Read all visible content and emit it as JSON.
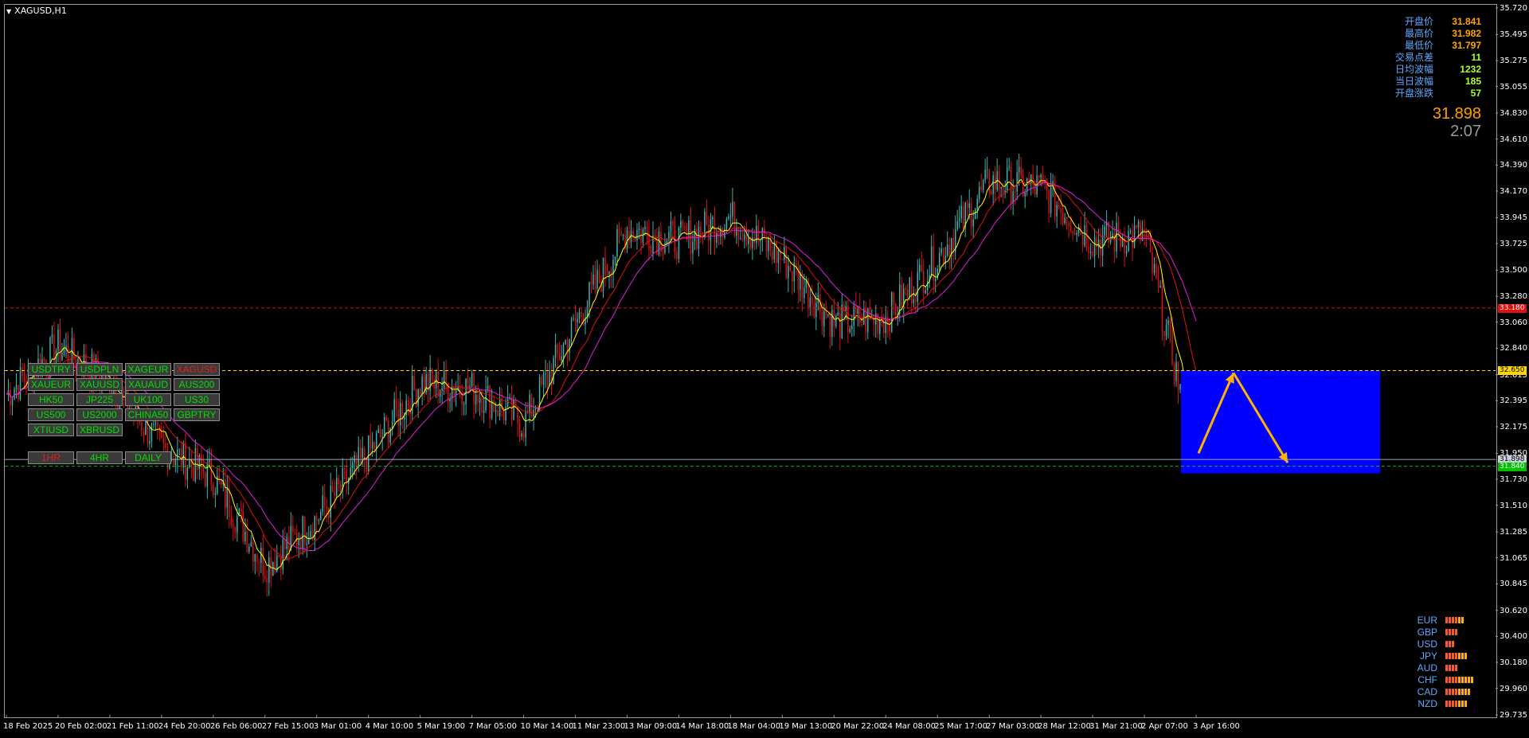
{
  "window": {
    "title": "XAGUSD,H1"
  },
  "symbol_buttons": [
    {
      "label": "USDTRY",
      "active": false
    },
    {
      "label": "USDPLN",
      "active": false
    },
    {
      "label": "XAGEUR",
      "active": false
    },
    {
      "label": "XAGUSD",
      "active": true
    },
    {
      "label": "XAUEUR",
      "active": false
    },
    {
      "label": "XAUUSD",
      "active": false
    },
    {
      "label": "XAUAUD",
      "active": false
    },
    {
      "label": "AUS200",
      "active": false
    },
    {
      "label": "HK50",
      "active": false
    },
    {
      "label": "JP225",
      "active": false
    },
    {
      "label": "UK100",
      "active": false
    },
    {
      "label": "US30",
      "active": false
    },
    {
      "label": "US500",
      "active": false
    },
    {
      "label": "US2000",
      "active": false
    },
    {
      "label": "CHINA50",
      "active": false
    },
    {
      "label": "GBPTRY",
      "active": false
    },
    {
      "label": "XTIUSD",
      "active": false
    },
    {
      "label": "XBRUSD",
      "active": false
    }
  ],
  "timeframe_buttons": [
    {
      "label": "1HR",
      "active": true
    },
    {
      "label": "4HR",
      "active": false
    },
    {
      "label": "DAILY",
      "active": false
    }
  ],
  "info_panel": [
    {
      "label": "开盘价",
      "value": "31.841"
    },
    {
      "label": "最高价",
      "value": "31.982"
    },
    {
      "label": "最低价",
      "value": "31.797"
    },
    {
      "label": "交易点差",
      "value": "11"
    },
    {
      "label": "日均波幅",
      "value": "1232"
    },
    {
      "label": "当日波幅",
      "value": "185"
    },
    {
      "label": "开盘涨跌",
      "value": "57"
    }
  ],
  "current_price": "31.898",
  "bar_countdown": "2:07",
  "currency_strength": [
    {
      "currency": "EUR",
      "level": 6
    },
    {
      "currency": "GBP",
      "level": 4
    },
    {
      "currency": "USD",
      "level": 3
    },
    {
      "currency": "JPY",
      "level": 7
    },
    {
      "currency": "AUD",
      "level": 4
    },
    {
      "currency": "CHF",
      "level": 9
    },
    {
      "currency": "CAD",
      "level": 8
    },
    {
      "currency": "NZD",
      "level": 7
    }
  ],
  "price_axis": [
    "35.720",
    "35.495",
    "35.275",
    "35.055",
    "34.830",
    "34.610",
    "34.390",
    "34.170",
    "33.945",
    "33.725",
    "33.500",
    "33.280",
    "33.060",
    "32.840",
    "32.615",
    "32.395",
    "32.175",
    "31.950",
    "31.730",
    "31.510",
    "31.285",
    "31.065",
    "30.845",
    "30.620",
    "30.400",
    "30.180",
    "29.960",
    "29.735"
  ],
  "price_tags": {
    "resistance": "33.180",
    "upper": "32.650",
    "bid": "31.898",
    "ask": "31.840"
  },
  "time_axis": [
    "18 Feb 2025",
    "20 Feb 02:00",
    "21 Feb 11:00",
    "24 Feb 20:00",
    "26 Feb 06:00",
    "27 Feb 15:00",
    "3 Mar 01:00",
    "4 Mar 10:00",
    "5 Mar 19:00",
    "7 Mar 05:00",
    "10 Mar 14:00",
    "11 Mar 23:00",
    "13 Mar 09:00",
    "14 Mar 18:00",
    "18 Mar 04:00",
    "19 Mar 13:00",
    "20 Mar 22:00",
    "24 Mar 08:00",
    "25 Mar 17:00",
    "27 Mar 03:00",
    "28 Mar 12:00",
    "31 Mar 21:00",
    "2 Apr 07:00",
    "3 Apr 16:00"
  ],
  "colors": {
    "bull_candle": "#3fb2b2",
    "bear_candle": "#e01010",
    "ma_fast": "#ffff00",
    "ma_mid": "#e01010",
    "ma_slow": "#e020e0",
    "zone": "#0000ff",
    "arrow": "#ffb300"
  },
  "chart_data": {
    "type": "candlestick",
    "symbol": "XAGUSD",
    "timeframe": "H1",
    "ylim": [
      29.735,
      35.72
    ],
    "close_path": [
      {
        "x": "18 Feb 2025",
        "y": 32.45
      },
      {
        "x": "20 Feb 02:00",
        "y": 32.85
      },
      {
        "x": "21 Feb 11:00",
        "y": 32.55
      },
      {
        "x": "24 Feb 20:00",
        "y": 32.0
      },
      {
        "x": "26 Feb 06:00",
        "y": 31.75
      },
      {
        "x": "27 Feb 15:00",
        "y": 31.0
      },
      {
        "x": "3 Mar 01:00",
        "y": 31.4
      },
      {
        "x": "4 Mar 10:00",
        "y": 31.95
      },
      {
        "x": "5 Mar 19:00",
        "y": 32.55
      },
      {
        "x": "7 Mar 05:00",
        "y": 32.5
      },
      {
        "x": "10 Mar 14:00",
        "y": 32.2
      },
      {
        "x": "11 Mar 23:00",
        "y": 33.05
      },
      {
        "x": "13 Mar 09:00",
        "y": 33.85
      },
      {
        "x": "14 Mar 18:00",
        "y": 33.75
      },
      {
        "x": "18 Mar 04:00",
        "y": 33.95
      },
      {
        "x": "19 Mar 13:00",
        "y": 33.6
      },
      {
        "x": "20 Mar 22:00",
        "y": 33.05
      },
      {
        "x": "24 Mar 08:00",
        "y": 33.1
      },
      {
        "x": "25 Mar 17:00",
        "y": 33.6
      },
      {
        "x": "27 Mar 03:00",
        "y": 34.25
      },
      {
        "x": "28 Mar 12:00",
        "y": 34.2
      },
      {
        "x": "31 Mar 21:00",
        "y": 33.75
      },
      {
        "x": "2 Apr 07:00",
        "y": 33.8
      },
      {
        "x": "3 Apr 16:00",
        "y": 31.9
      }
    ],
    "horizontal_lines": [
      {
        "price": 33.18,
        "style": "dashed",
        "color": "#e01010"
      },
      {
        "price": 32.65,
        "style": "dashed",
        "color": "#ffd700"
      },
      {
        "price": 31.898,
        "style": "solid",
        "color": "#9aa4b0"
      },
      {
        "price": 31.84,
        "style": "dashed",
        "color": "#00c000"
      }
    ],
    "zone": {
      "price_top": 32.65,
      "price_bottom": 31.78
    },
    "arrows": [
      {
        "from_price": 31.95,
        "to_price": 32.63
      },
      {
        "from_price": 32.63,
        "to_price": 31.87
      }
    ]
  }
}
